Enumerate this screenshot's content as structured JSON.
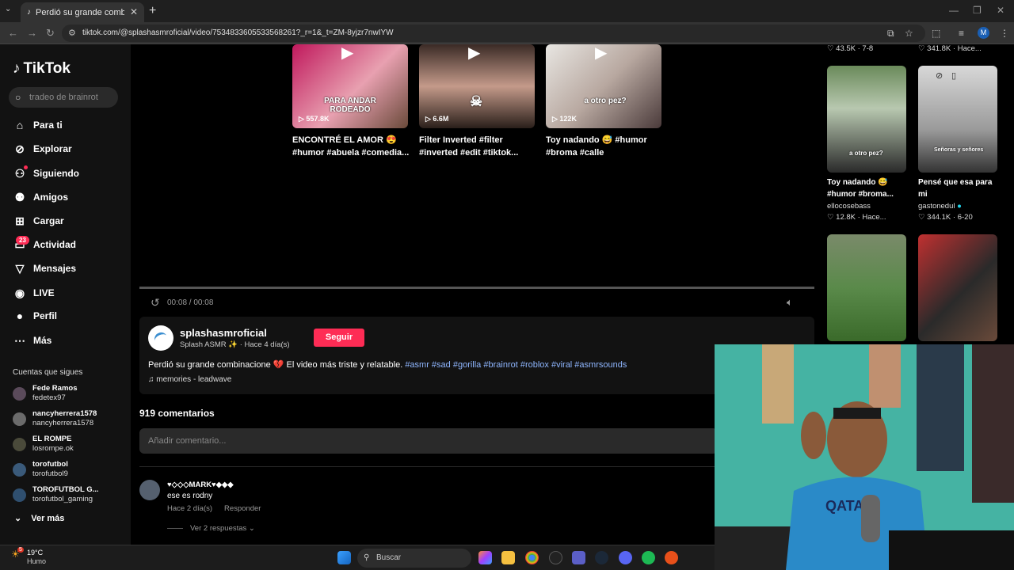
{
  "browser": {
    "tab_title": "Perdió su grande combinacione",
    "url": "tiktok.com/@splashasmroficial/video/7534833605533568261?_r=1&_t=ZM-8yjzr7nwIYW"
  },
  "sidebar": {
    "logo": "TikTok",
    "search_placeholder": "tradeo de brainrot",
    "nav": [
      {
        "label": "Para ti",
        "icon": "home-icon"
      },
      {
        "label": "Explorar",
        "icon": "compass-icon"
      },
      {
        "label": "Siguiendo",
        "icon": "following-icon"
      },
      {
        "label": "Amigos",
        "icon": "friends-icon"
      },
      {
        "label": "Cargar",
        "icon": "upload-icon"
      },
      {
        "label": "Actividad",
        "icon": "activity-icon"
      },
      {
        "label": "Mensajes",
        "icon": "messages-icon"
      },
      {
        "label": "LIVE",
        "icon": "live-icon"
      },
      {
        "label": "Perfil",
        "icon": "profile-icon"
      },
      {
        "label": "Más",
        "icon": "more-icon"
      }
    ],
    "activity_badge": "23",
    "following_title": "Cuentas que sigues",
    "following": [
      {
        "name": "Fede Ramos",
        "handle": "fedetex97"
      },
      {
        "name": "nancyherrera1578",
        "handle": "nancyherrera1578"
      },
      {
        "name": "EL ROMPE",
        "handle": "losrompe.ok"
      },
      {
        "name": "torofutbol",
        "handle": "torofutbol9"
      },
      {
        "name": "TOROFUTBOL G...",
        "handle": "torofutbol_gaming"
      }
    ],
    "see_more": "Ver más"
  },
  "related": [
    {
      "views": "557.8K",
      "caption": "PARA ANDAR RODEADO",
      "title": "ENCONTRÉ EL AMOR 😍 #humor #abuela #comedia..."
    },
    {
      "views": "6.6M",
      "caption": "",
      "title": "Filter Inverted #filter #inverted #edit #tiktok..."
    },
    {
      "views": "122K",
      "caption": "a otro pez?",
      "title": "Toy nadando 😅 #humor #broma #calle"
    }
  ],
  "player": {
    "time": "00:08 / 00:08"
  },
  "author": {
    "name": "splashasmroficial",
    "sub": "Splash ASMR ✨ · Hace 4 día(s)",
    "follow": "Seguir",
    "desc_text": "Perdió su grande combinacione 💔 El video más triste y relatable.",
    "desc_tags": "#asmr #sad #gorilla #brainrot #roblox #viral #asmrsounds",
    "music": "♫ memories - leadwave"
  },
  "comments": {
    "count": "919 comentarios",
    "placeholder": "Añadir comentario...",
    "item": {
      "user": "♥◇◇◇MARK♥◆◆◆",
      "text": "ese es rodny",
      "meta": "Hace 2 día(s)",
      "reply": "Responder",
      "replies": "Ver 2 respuestas ⌄"
    }
  },
  "right": {
    "top_stats": [
      "♡ 43.5K · 7-8",
      "♡ 341.8K · Hace..."
    ],
    "cards": [
      {
        "title": "Toy nadando 😅 #humor #broma...",
        "author": "ellocosebass",
        "stat": "♡ 12.8K · Hace...",
        "caption": "a otro pez?"
      },
      {
        "title": "Pensé que esa para mi",
        "author": "gastonedul",
        "stat": "♡ 344.1K · 6-20",
        "caption": "Señoras y señores"
      }
    ]
  },
  "taskbar": {
    "temp": "19°C",
    "cond": "Humo",
    "weather_badge": "5",
    "search": "Buscar"
  }
}
